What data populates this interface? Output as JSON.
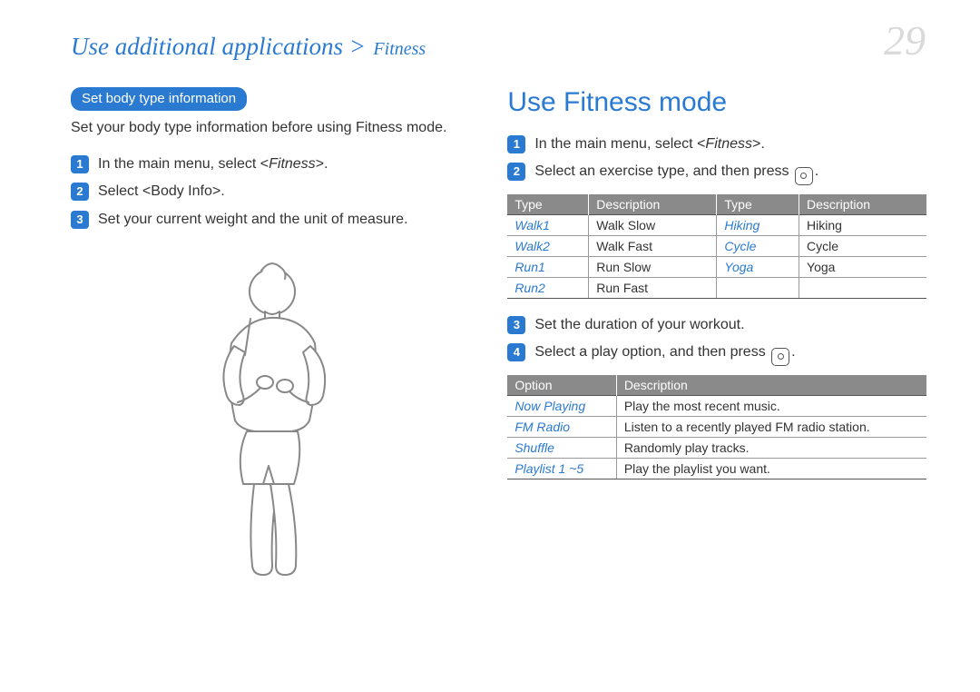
{
  "header": {
    "breadcrumb_main": "Use additional applications >",
    "breadcrumb_sub": "Fitness",
    "page_number": "29"
  },
  "left": {
    "pill": "Set body type information",
    "intro": "Set your body type information before using Fitness mode.",
    "steps": [
      {
        "pre": "In the main menu, select <",
        "em": "Fitness",
        "post": ">."
      },
      {
        "pre": "Select <",
        "em": "",
        "post": "Body Info>."
      },
      {
        "pre": "Set your current weight and the unit of measure.",
        "em": "",
        "post": ""
      }
    ]
  },
  "right": {
    "title": "Use Fitness mode",
    "steps1": [
      {
        "pre": "In the main menu, select <",
        "em": "Fitness",
        "post": ">."
      },
      {
        "pre": "Select an exercise type, and then press ",
        "em": "",
        "post": "",
        "button": true,
        "tail": "."
      }
    ],
    "exercise_table": {
      "headers": [
        "Type",
        "Description",
        "Type",
        "Description"
      ],
      "rows": [
        [
          "Walk1",
          "Walk Slow",
          "Hiking",
          "Hiking"
        ],
        [
          "Walk2",
          "Walk Fast",
          "Cycle",
          "Cycle"
        ],
        [
          "Run1",
          "Run Slow",
          "Yoga",
          "Yoga"
        ],
        [
          "Run2",
          "Run Fast",
          "",
          ""
        ]
      ]
    },
    "steps2": [
      {
        "num": "3",
        "pre": "Set the duration of your workout.",
        "em": "",
        "post": ""
      },
      {
        "num": "4",
        "pre": "Select a play option, and then press ",
        "em": "",
        "post": "",
        "button": true,
        "tail": "."
      }
    ],
    "option_table": {
      "headers": [
        "Option",
        "Description"
      ],
      "rows": [
        [
          "Now Playing",
          "Play the most recent music."
        ],
        [
          "FM Radio",
          "Listen to a recently played FM radio station."
        ],
        [
          "Shuffle",
          "Randomly play tracks."
        ],
        [
          "Playlist 1 ~5",
          "Play the playlist you want."
        ]
      ]
    }
  }
}
